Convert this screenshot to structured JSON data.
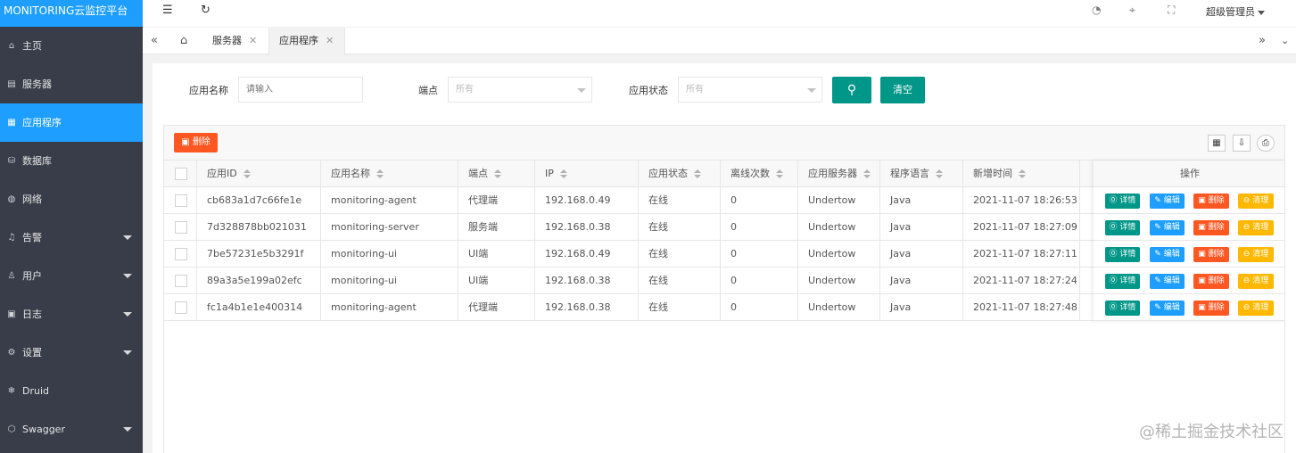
{
  "app": {
    "title": "MONITORING云监控平台"
  },
  "colors": {
    "primary": "#1e9fff",
    "teal": "#009688",
    "danger": "#ff5722",
    "warn": "#ffb800",
    "sidebar": "#393d49"
  },
  "sidebar": {
    "items": [
      {
        "label": "主页",
        "icon": "home-icon",
        "glyph": "⌂",
        "has_submenu": false,
        "active": false
      },
      {
        "label": "服务器",
        "icon": "server-icon",
        "glyph": "▤",
        "has_submenu": false,
        "active": false
      },
      {
        "label": "应用程序",
        "icon": "apps-icon",
        "glyph": "▦",
        "has_submenu": false,
        "active": true
      },
      {
        "label": "数据库",
        "icon": "database-icon",
        "glyph": "⛁",
        "has_submenu": false,
        "active": false
      },
      {
        "label": "网络",
        "icon": "network-icon",
        "glyph": "◍",
        "has_submenu": false,
        "active": false
      },
      {
        "label": "告警",
        "icon": "bell-icon",
        "glyph": "♫",
        "has_submenu": true,
        "active": false
      },
      {
        "label": "用户",
        "icon": "user-icon",
        "glyph": "♙",
        "has_submenu": true,
        "active": false
      },
      {
        "label": "日志",
        "icon": "log-icon",
        "glyph": "▣",
        "has_submenu": true,
        "active": false
      },
      {
        "label": "设置",
        "icon": "settings-icon",
        "glyph": "⚙",
        "has_submenu": true,
        "active": false
      },
      {
        "label": "Druid",
        "icon": "druid-icon",
        "glyph": "❄",
        "has_submenu": false,
        "active": false
      },
      {
        "label": "Swagger",
        "icon": "swagger-icon",
        "glyph": "⬡",
        "has_submenu": true,
        "active": false
      }
    ]
  },
  "header": {
    "user_name": "超级管理员",
    "icons": [
      "menu-toggle-icon",
      "refresh-icon",
      "theme-icon",
      "tag-icon",
      "fullscreen-icon"
    ]
  },
  "tabs": {
    "items": [
      {
        "label": "服务器",
        "active": false
      },
      {
        "label": "应用程序",
        "active": true
      }
    ]
  },
  "filters": {
    "name_label": "应用名称",
    "name_placeholder": "请输入",
    "endpoint_label": "端点",
    "endpoint_value": "所有",
    "status_label": "应用状态",
    "status_value": "所有",
    "clear_label": "清空"
  },
  "toolbar": {
    "delete_label": "删除"
  },
  "table": {
    "columns": [
      "应用ID",
      "应用名称",
      "端点",
      "IP",
      "应用状态",
      "离线次数",
      "应用服务器",
      "程序语言",
      "新增时间"
    ],
    "ops_header": "操作",
    "ops_labels": {
      "detail": "详情",
      "edit": "编辑",
      "remove": "删除",
      "clean": "清理"
    },
    "rows": [
      [
        "cb683a1d7c66fe1e",
        "monitoring-agent",
        "代理端",
        "192.168.0.49",
        "在线",
        "0",
        "Undertow",
        "Java",
        "2021-11-07 18:26:53"
      ],
      [
        "7d328878bb021031",
        "monitoring-server",
        "服务端",
        "192.168.0.38",
        "在线",
        "0",
        "Undertow",
        "Java",
        "2021-11-07 18:27:09"
      ],
      [
        "7be57231e5b3291f",
        "monitoring-ui",
        "UI端",
        "192.168.0.49",
        "在线",
        "0",
        "Undertow",
        "Java",
        "2021-11-07 18:27:11"
      ],
      [
        "89a3a5e199a02efc",
        "monitoring-ui",
        "UI端",
        "192.168.0.38",
        "在线",
        "0",
        "Undertow",
        "Java",
        "2021-11-07 18:27:24"
      ],
      [
        "fc1a4b1e1e400314",
        "monitoring-agent",
        "代理端",
        "192.168.0.38",
        "在线",
        "0",
        "Undertow",
        "Java",
        "2021-11-07 18:27:48"
      ]
    ]
  },
  "watermark": "@稀土掘金技术社区"
}
